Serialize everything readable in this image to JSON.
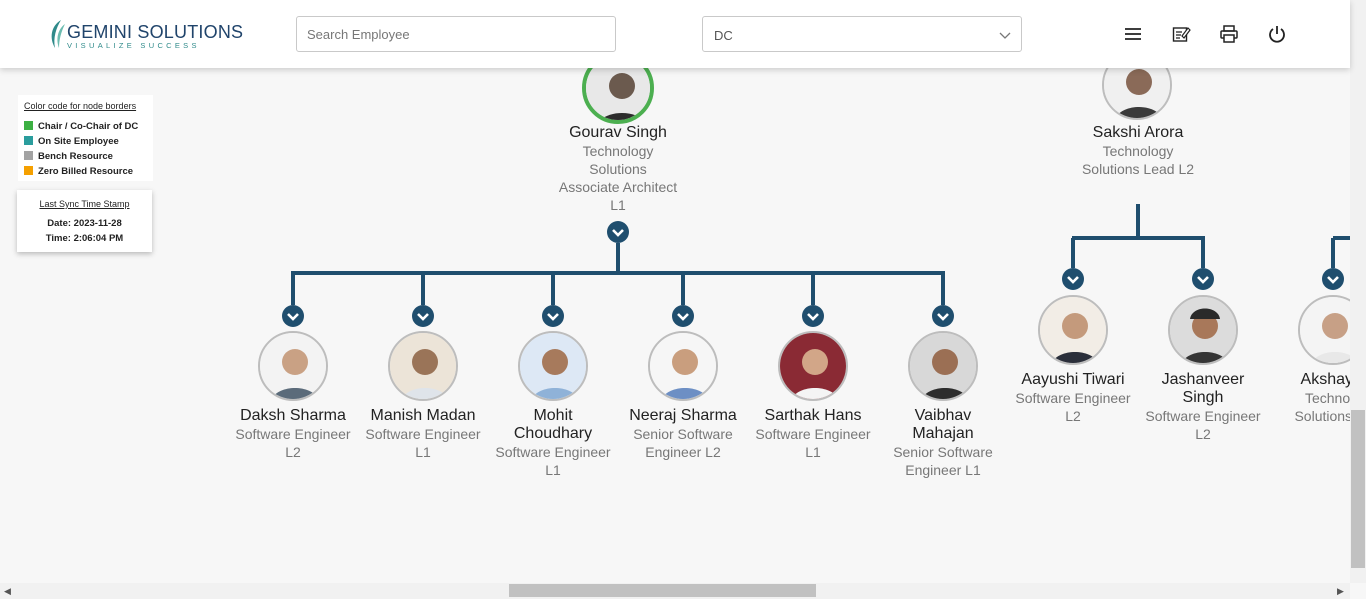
{
  "header": {
    "logo_main": "GEMINI SOLUTIONS",
    "logo_tagline": "VISUALIZE SUCCESS",
    "search_placeholder": "Search Employee",
    "dc_select_value": "DC",
    "icons": [
      "menu-icon",
      "edit-note-icon",
      "print-icon",
      "power-icon"
    ]
  },
  "legend": {
    "title": "Color code for node borders",
    "items": [
      {
        "label": "Chair / Co-Chair of DC",
        "color": "#3cb043"
      },
      {
        "label": "On Site Employee",
        "color": "#2a9d9d"
      },
      {
        "label": "Bench Resource",
        "color": "#a3a3a3"
      },
      {
        "label": "Zero Billed Resource",
        "color": "#f5a000"
      }
    ]
  },
  "sync": {
    "title": "Last Sync Time Stamp",
    "date": "Date: 2023-11-28",
    "time": "Time: 2:06:04 PM"
  },
  "colors": {
    "connector": "#1f4e6e",
    "chair_border": "#4caf50"
  },
  "managers": [
    {
      "name": "Gourav Singh",
      "lines": [
        "Technology",
        "Solutions",
        "Associate Architect",
        "L1"
      ]
    },
    {
      "name": "Sakshi Arora",
      "lines": [
        "Technology",
        "Solutions Lead L2"
      ]
    }
  ],
  "reports_gourav": [
    {
      "name": "Daksh Sharma",
      "lines": [
        "Software Engineer",
        "L2"
      ]
    },
    {
      "name": "Manish Madan",
      "lines": [
        "Software Engineer",
        "L1"
      ]
    },
    {
      "name": "Mohit",
      "name2": "Choudhary",
      "lines": [
        "Software Engineer",
        "L1"
      ]
    },
    {
      "name": "Neeraj Sharma",
      "lines": [
        "Senior Software",
        "Engineer L2"
      ]
    },
    {
      "name": "Sarthak Hans",
      "lines": [
        "Software Engineer",
        "L1"
      ]
    },
    {
      "name": "Vaibhav",
      "name2": "Mahajan",
      "lines": [
        "Senior Software",
        "Engineer L1"
      ]
    }
  ],
  "reports_sakshi": [
    {
      "name": "Aayushi Tiwari",
      "lines": [
        "Software Engineer",
        "L2"
      ]
    },
    {
      "name": "Jashanveer",
      "name2": "Singh",
      "lines": [
        "Software Engineer",
        "L2"
      ]
    },
    {
      "name": "Akshay J",
      "lines": [
        "Technolo",
        "Solutions Le"
      ]
    }
  ]
}
